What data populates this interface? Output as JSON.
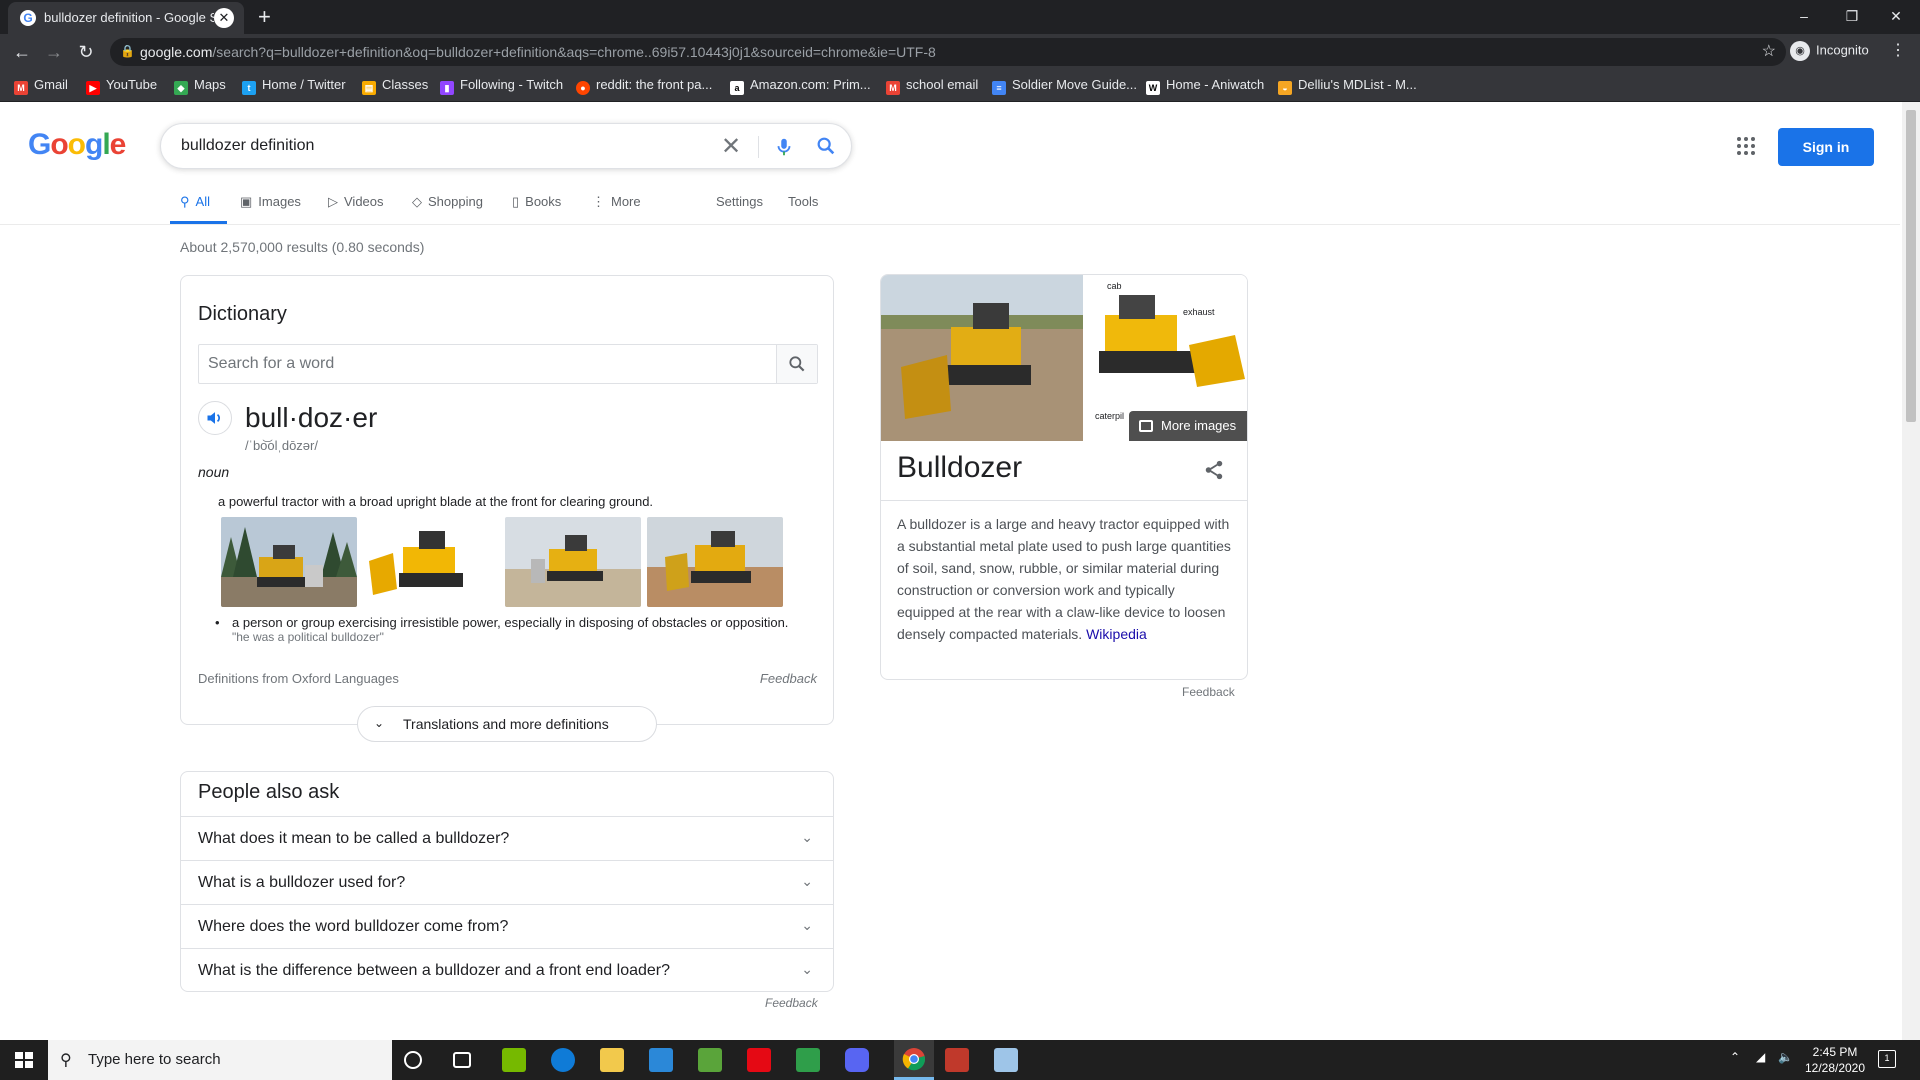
{
  "browser": {
    "tab_title": "bulldozer definition - Google Sea",
    "url_host": "google.com",
    "url_rest": "/search?q=bulldozer+definition&oq=bulldozer+definition&aqs=chrome..69i57.10443j0j1&sourceid=chrome&ie=UTF-8",
    "profile_label": "Incognito",
    "bookmarks": [
      {
        "label": "Gmail",
        "icon": "gmail-icon",
        "color": "#ea4335"
      },
      {
        "label": "YouTube",
        "icon": "youtube-icon",
        "color": "#ff0000"
      },
      {
        "label": "Maps",
        "icon": "maps-icon",
        "color": "#34a853"
      },
      {
        "label": "Home / Twitter",
        "icon": "twitter-icon",
        "color": "#1da1f2"
      },
      {
        "label": "Classes",
        "icon": "classroom-icon",
        "color": "#f9ab00"
      },
      {
        "label": "Following - Twitch",
        "icon": "twitch-icon",
        "color": "#9146ff"
      },
      {
        "label": "reddit: the front pa...",
        "icon": "reddit-icon",
        "color": "#ff4500"
      },
      {
        "label": "Amazon.com: Prim...",
        "icon": "amazon-icon",
        "color": "#ffffff"
      },
      {
        "label": "school email",
        "icon": "gmail-icon",
        "color": "#ea4335"
      },
      {
        "label": "Soldier Move Guide...",
        "icon": "docs-icon",
        "color": "#4285f4"
      },
      {
        "label": "Home - Aniwatch",
        "icon": "aniwatch-icon",
        "color": "#ffffff"
      },
      {
        "label": "Delliu's MDList - M...",
        "icon": "mdlist-icon",
        "color": "#f5a623"
      }
    ]
  },
  "google": {
    "logo_letters": [
      "G",
      "o",
      "o",
      "g",
      "l",
      "e"
    ],
    "query": "bulldozer definition",
    "signin_label": "Sign in",
    "tabs": [
      {
        "label": "All",
        "icon": "search-icon"
      },
      {
        "label": "Images",
        "icon": "image-icon"
      },
      {
        "label": "Videos",
        "icon": "video-icon"
      },
      {
        "label": "Shopping",
        "icon": "tag-icon"
      },
      {
        "label": "Books",
        "icon": "book-icon"
      },
      {
        "label": "More",
        "icon": "more-vert-icon"
      }
    ],
    "settings_label": "Settings",
    "tools_label": "Tools",
    "result_stats": "About 2,570,000 results (0.80 seconds)"
  },
  "dictionary": {
    "title": "Dictionary",
    "search_placeholder": "Search for a word",
    "headword": "bull·doz·er",
    "pronunciation": "/ˈbo͝olˌdōzər/",
    "part_of_speech": "noun",
    "definition_1": "a powerful tractor with a broad upright blade at the front for clearing ground.",
    "definition_2": "a person or group exercising irresistible power, especially in disposing of obstacles or opposition.",
    "example_2": "\"he was a political bulldozer\"",
    "source": "Definitions from Oxford Languages",
    "feedback": "Feedback",
    "translations_label": "Translations and more definitions"
  },
  "people_also_ask": {
    "title": "People also ask",
    "questions": [
      "What does it mean to be called a bulldozer?",
      "What is a bulldozer used for?",
      "Where does the word bulldozer come from?",
      "What is the difference between a bulldozer and a front end loader?"
    ],
    "feedback": "Feedback"
  },
  "knowledge_panel": {
    "title": "Bulldozer",
    "more_images": "More images",
    "diagram_labels": [
      "cab",
      "exhaust",
      "caterpil"
    ],
    "description": "A bulldozer is a large and heavy tractor equipped with a substantial metal plate used to push large quantities of soil, sand, snow, rubble, or similar material during construction or conversion work and typically equipped at the rear with a claw-like device to loosen densely compacted materials.",
    "source_link": "Wikipedia",
    "feedback": "Feedback"
  },
  "taskbar": {
    "search_placeholder": "Type here to search",
    "time": "2:45 PM",
    "date": "12/28/2020",
    "notifications": "1"
  }
}
